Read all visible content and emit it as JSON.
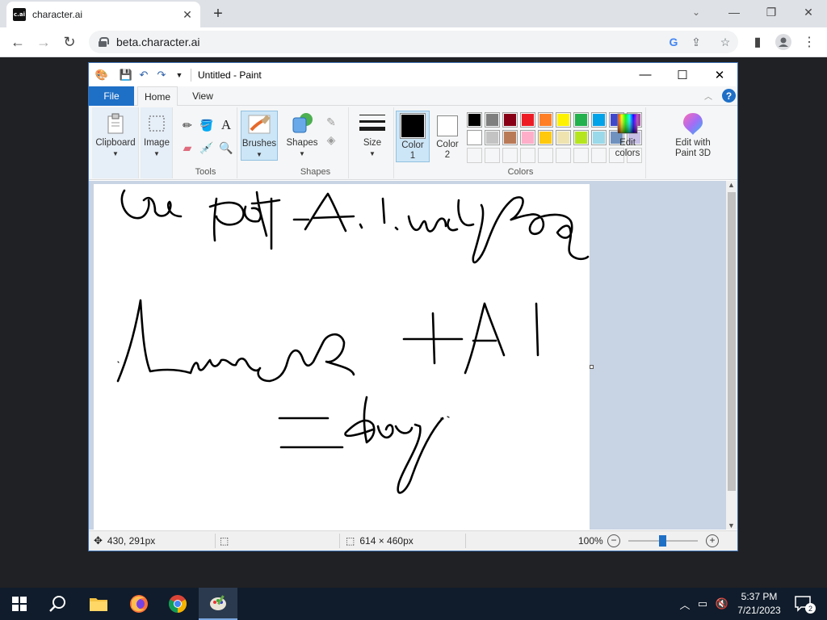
{
  "browser": {
    "tab_title": "character.ai",
    "favicon_text": "c.ai",
    "url": "beta.character.ai"
  },
  "paint": {
    "window_title": "Untitled - Paint",
    "ribbon_tabs": {
      "file": "File",
      "home": "Home",
      "view": "View"
    },
    "groups": {
      "clipboard": "Clipboard",
      "image": "Image",
      "tools": "Tools",
      "brushes": "Brushes",
      "shapes": "Shapes",
      "shapes_group": "Shapes",
      "size": "Size",
      "color1": "Color\n1",
      "color2": "Color\n2",
      "colors": "Colors",
      "edit_colors": "Edit\ncolors",
      "paint3d": "Edit with\nPaint 3D"
    },
    "palette_row1": [
      "#000000",
      "#7f7f7f",
      "#880015",
      "#ed1c24",
      "#ff7f27",
      "#fff200",
      "#22b14c",
      "#00a2e8",
      "#3f48cc",
      "#a349a4"
    ],
    "palette_row2": [
      "#ffffff",
      "#c3c3c3",
      "#b97a57",
      "#ffaec9",
      "#ffc90e",
      "#efe4b0",
      "#b5e61d",
      "#99d9ea",
      "#7092be",
      "#c8bfe7"
    ],
    "color1_value": "#000000",
    "color2_value": "#ffffff",
    "status": {
      "cursor_pos": "430, 291px",
      "canvas_size": "614 × 460px",
      "zoom": "100%"
    }
  },
  "taskbar": {
    "time": "5:37 PM",
    "date": "7/21/2023",
    "notification_count": "2"
  }
}
